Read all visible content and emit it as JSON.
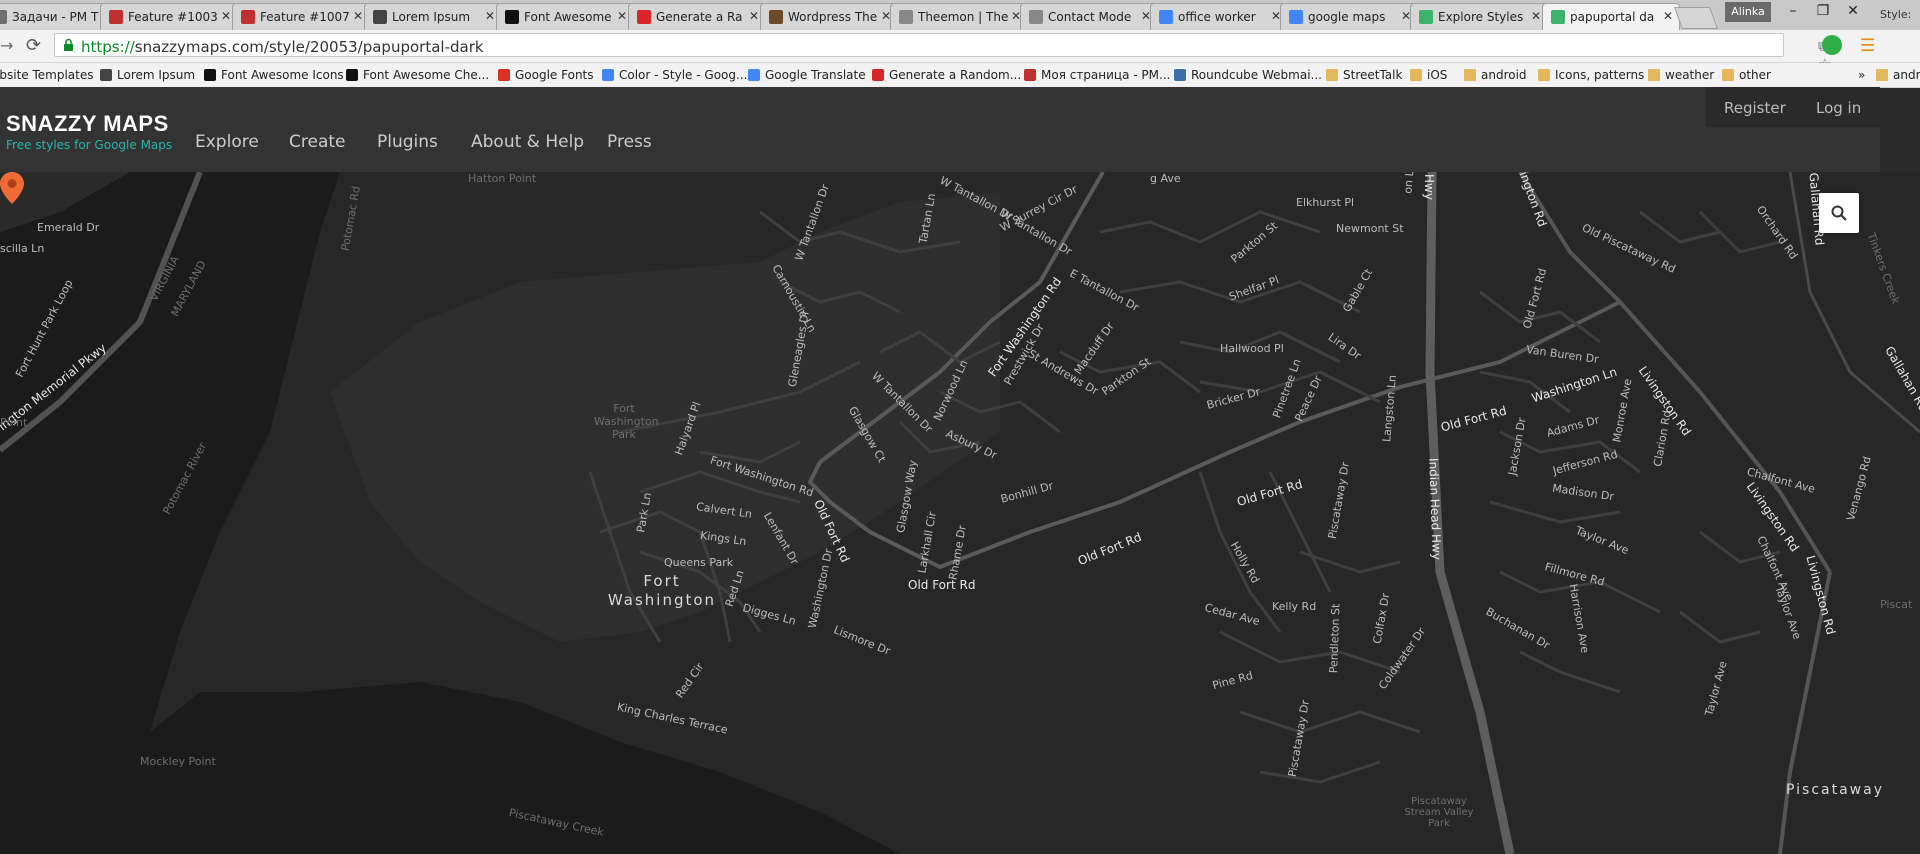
{
  "browser": {
    "tabs": [
      {
        "title": "Задачи - PM T",
        "icon": "document-icon",
        "color": "#6f6f6f"
      },
      {
        "title": "Feature #1003",
        "icon": "redmine-icon",
        "color": "#c03030"
      },
      {
        "title": "Feature #1007",
        "icon": "redmine-icon",
        "color": "#c03030"
      },
      {
        "title": "Lorem Ipsum",
        "icon": "lorem-icon",
        "color": "#444444"
      },
      {
        "title": "Font Awesome",
        "icon": "flag-icon",
        "color": "#111111"
      },
      {
        "title": "Generate a Ra",
        "icon": "generator-icon",
        "color": "#d9262a"
      },
      {
        "title": "Wordpress The",
        "icon": "wordpress-icon",
        "color": "#6b4a2a"
      },
      {
        "title": "Theemon | The",
        "icon": "document-icon",
        "color": "#888888"
      },
      {
        "title": "Contact Mode",
        "icon": "document-icon",
        "color": "#888888"
      },
      {
        "title": "office worker",
        "icon": "google-icon",
        "color": "#4285f4"
      },
      {
        "title": "google maps",
        "icon": "google-icon",
        "color": "#4285f4"
      },
      {
        "title": "Explore Styles",
        "icon": "map-pin-icon",
        "color": "#3db26b"
      },
      {
        "title": "papuportal da",
        "icon": "map-pin-icon",
        "color": "#3db26b"
      }
    ],
    "overflow_tab": "Style:",
    "user_badge": "Alinka",
    "window_buttons": {
      "minimize": "–",
      "restore": "❐",
      "close": "✕"
    },
    "url": {
      "scheme": "https://",
      "host": "snazzymaps.com",
      "path": "/style/20053/papuportal-dark"
    },
    "bookmarks": [
      {
        "label": "ebsite Templates",
        "icon": "none"
      },
      {
        "label": "Lorem Ipsum",
        "icon": "lorem-icon"
      },
      {
        "label": "Font Awesome Icons",
        "icon": "flag-icon"
      },
      {
        "label": "Font Awesome Che...",
        "icon": "flag-icon"
      },
      {
        "label": "Google Fonts",
        "icon": "fonts-icon"
      },
      {
        "label": "Color - Style - Goog...",
        "icon": "google-icon"
      },
      {
        "label": "Google Translate",
        "icon": "translate-icon"
      },
      {
        "label": "Generate a Random...",
        "icon": "generator-icon"
      },
      {
        "label": "Моя страница - PM...",
        "icon": "redmine-icon"
      },
      {
        "label": "Roundcube Webmai...",
        "icon": "roundcube-icon"
      },
      {
        "label": "StreetTalk",
        "icon": "folder-icon"
      },
      {
        "label": "iOS",
        "icon": "folder-icon"
      },
      {
        "label": "android",
        "icon": "folder-icon"
      },
      {
        "label": "Icons, patterns",
        "icon": "folder-icon"
      },
      {
        "label": "weather",
        "icon": "folder-icon"
      },
      {
        "label": "other",
        "icon": "folder-icon"
      }
    ],
    "bookmarks_overflow": "»",
    "bookmarks_right_folder": "andro"
  },
  "site": {
    "logo_title": "SNAZZY MAPS",
    "logo_subtitle": "Free styles for Google Maps",
    "nav": [
      "Explore",
      "Create",
      "Plugins",
      "About & Help",
      "Press"
    ],
    "account": {
      "register": "Register",
      "login": "Log in"
    },
    "accent_color": "#29b3a8"
  },
  "map": {
    "marker_color": "#f06a35",
    "search_icon": "search-icon",
    "labels": {
      "emerald_dr": "Emerald Dr",
      "oscilla_ln": "scilla Ln",
      "virginia": "VIRGINIA",
      "maryland": "MARYLAND",
      "fort_hunt_park_loop": "Fort Hunt Park Loop",
      "memorial_pkwy": "ington Memorial Pkwy",
      "potomac_river": "Potomac River",
      "point": "Point",
      "potomac_rd": "Potomac Rd",
      "hatton_point": "Hatton Point",
      "mockley_point": "Mockley Point",
      "piscataway_creek": "Piscataway Creek",
      "fort_washington_park": "Fort Washington Park",
      "fort_washington": "Fort Washington",
      "queens_park": "Queens Park",
      "halyard_pl": "Halyard Pl",
      "park_ln": "Park Ln",
      "calvert_ln": "Calvert Ln",
      "kings_ln": "Kings Ln",
      "lenfant_dr": "Lenfant Dr",
      "red_ln": "Red Ln",
      "digges_ln": "Digges Ln",
      "red_cir": "Red Cir",
      "king_charles_terrace": "King Charles Terrace",
      "washington_dr": "Washington Dr",
      "lismore_dr": "Lismore Dr",
      "fort_washington_rd_1": "Fort Washington Rd",
      "fort_washington_rd_2": "Fort Washington Rd",
      "old_fort_rd_1": "Old Fort Rd",
      "old_fort_rd_2": "Old Fort Rd",
      "old_fort_rd_3": "Old Fort Rd",
      "old_fort_rd_4": "Old Fort Rd",
      "old_fort_rd_5": "Old Fort Rd",
      "w_tantallon_dr_1": "W Tantallon Dr",
      "w_tantallon_dr_2": "W Tantallon Dr",
      "w_tantallon_dr_3": "W Tantallon Dr",
      "w_tantallon_dr_4": "W Tantallon Dr",
      "w_surrey_cir_dr": "W Surrey Cir Dr",
      "tartan_ln": "Tartan Ln",
      "carnoustie_ln": "Carnoustie Ln",
      "gleneagles_dr": "Gleneagles Dr",
      "norwood_ln": "Norwood Ln",
      "glasgow_ct": "Glasgow Ct",
      "glasgow_way": "Glasgow Way",
      "larkhall_cir": "Larkhall Cir",
      "rhame_dr": "Rhame Dr",
      "asbury_dr": "Asbury Dr",
      "bonhill_dr": "Bonhill Dr",
      "prestwick_dr": "Prestwick Dr",
      "st_andrews_dr": "St Andrews Dr",
      "macduff_dr": "Macduff Dr",
      "parkton_st_1": "Parkton St",
      "parkton_st_2": "Parkton St",
      "e_tantallon_dr": "E Tantallon Dr",
      "elkhurst_pl": "Elkhurst Pl",
      "newmont_st": "Newmont St",
      "shelfar_pl": "Shelfar Pl",
      "gable_ct": "Gable Ct",
      "hallwood_pl": "Hallwood Pl",
      "lira_dr": "Lira Dr",
      "bricker_dr": "Bricker Dr",
      "pinetree_ln": "Pinetree Ln",
      "peace_dr": "Peace Dr",
      "langston_ln": "Langston Ln",
      "piscataway_dr_1": "Piscataway Dr",
      "piscataway_dr_2": "Piscataway Dr",
      "holly_rd": "Holly Rd",
      "kelly_rd": "Kelly Rd",
      "cedar_ave": "Cedar Ave",
      "pine_rd": "Pine Rd",
      "pendleton_st": "Pendleton St",
      "colfax_dr": "Colfax Dr",
      "coldwater_dr": "Coldwater Dr",
      "indian_head_hwy_1": "Indian Head Hwy",
      "indian_head_hwy_2": "Hwy",
      "livingston_rd_top": "ington Rd",
      "old_piscataway_rd": "Old Piscataway Rd",
      "old_fort_rd_east": "Old Fort Rd",
      "van_buren_dr": "Van Buren Dr",
      "washington_ln": "Washington Ln",
      "monroe_ave": "Monroe Ave",
      "adams_dr": "Adams Dr",
      "jackson_dr": "Jackson Dr",
      "jefferson_rd": "Jefferson Rd",
      "madison_dr": "Madison Dr",
      "clarion_rd": "Clarion Rd",
      "livingston_rd_1": "Livingston Rd",
      "livingston_rd_2": "Livingston Rd",
      "livingston_rd_3": "Livingston Rd",
      "taylor_ave_1": "Taylor Ave",
      "taylor_ave_2": "Taylor Ave",
      "taylor_ave_3": "Taylor Ave",
      "fillmore_rd": "Fillmore Rd",
      "harrison_ave": "Harrison Ave",
      "buchanan_dr": "Buchanan Dr",
      "chalfont_ave_1": "Chalfont Ave",
      "chalfont_ave_2": "Chalfont Ave",
      "venango_rd": "Venango Rd",
      "orchard_rd": "Orchard Rd",
      "gallahan_rd_1": "Gallahan Rd",
      "gallahan_rd_2": "Gallahan Rd",
      "tinkers_creek": "Tinkers Creek",
      "piscataway_town": "Piscataway",
      "piscataway_right": "Piscat",
      "piscataway_stream": "Piscataway Stream Valley Park",
      "on_ln": "on Ln",
      "ave": "g Ave"
    }
  }
}
